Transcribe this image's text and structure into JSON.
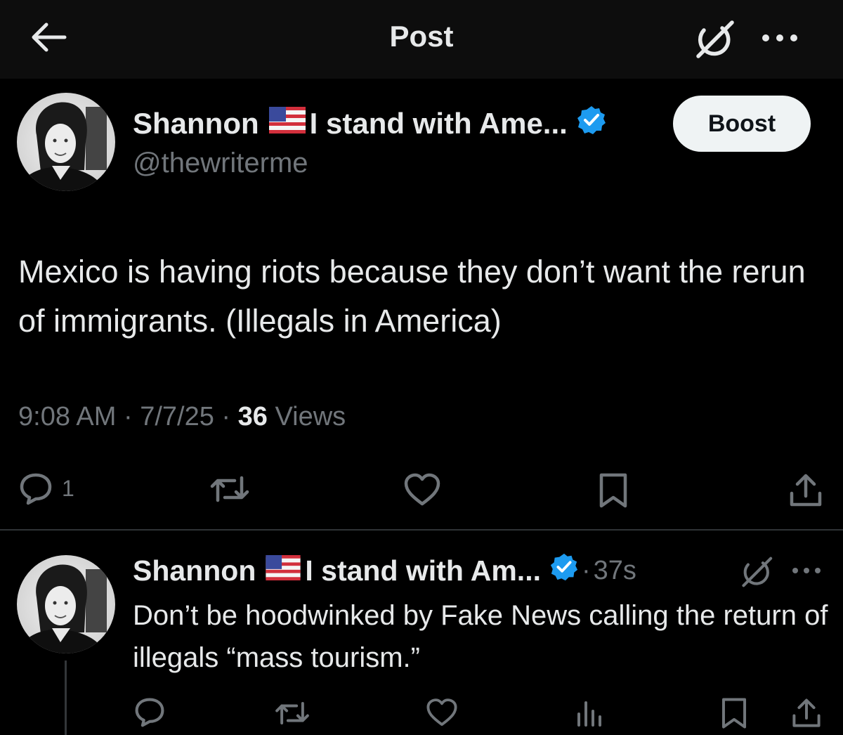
{
  "header": {
    "title": "Post",
    "back_icon": "arrow-left-icon",
    "grok_icon": "grok-icon",
    "more_icon": "more-horizontal-icon"
  },
  "post": {
    "author_name": "Shannon",
    "author_flag": "us-flag",
    "author_tagline": "I stand with Ame...",
    "verified_icon": "verified-badge-icon",
    "handle": "@thewriterme",
    "boost_label": "Boost",
    "text": "Mexico is having riots because they don’t want the rerun of immigrants. (Illegals in America)",
    "time": "9:08 AM",
    "date": "7/7/25",
    "views_count": "36",
    "views_label": "Views",
    "reply_count": "1",
    "accent_color": "#1d9bf0"
  },
  "reply": {
    "author_name": "Shannon",
    "author_tagline": "I stand with Am...",
    "time": "37s",
    "text": "Don’t be hoodwinked by Fake News calling the return of illegals “mass tourism.”"
  },
  "colors": {
    "background": "#000000",
    "primary_text": "#e7e9ea",
    "secondary_text": "#71767b",
    "divider": "#2f3336",
    "verified": "#1d9bf0",
    "button_bg": "#eff3f4"
  }
}
